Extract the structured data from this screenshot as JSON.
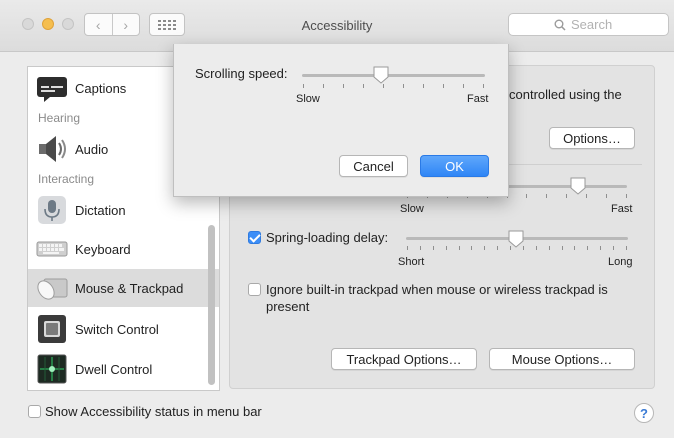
{
  "window": {
    "title": "Accessibility"
  },
  "toolbar": {
    "back_glyph": "‹",
    "forward_glyph": "›"
  },
  "search": {
    "placeholder": "Search"
  },
  "sidebar": {
    "items": [
      {
        "label": "Captions",
        "icon": "captions-icon"
      },
      {
        "label": "Audio",
        "icon": "speaker-icon"
      },
      {
        "label": "Dictation",
        "icon": "microphone-icon"
      },
      {
        "label": "Keyboard",
        "icon": "keyboard-icon"
      },
      {
        "label": "Mouse & Trackpad",
        "icon": "mouse-trackpad-icon",
        "selected": true
      },
      {
        "label": "Switch Control",
        "icon": "switch-control-icon"
      },
      {
        "label": "Dwell Control",
        "icon": "dwell-control-icon"
      }
    ],
    "headers": {
      "hearing": "Hearing",
      "interacting": "Interacting"
    }
  },
  "panel": {
    "partial_text": "controlled using the",
    "options_button": "Options…",
    "double_click_slider": {
      "min_label": "Slow",
      "max_label": "Fast",
      "value": 0.78
    },
    "spring_loading": {
      "label": "Spring-loading delay:",
      "checked": true,
      "min_label": "Short",
      "max_label": "Long",
      "value": 0.5
    },
    "ignore_trackpad": {
      "label_line1": "Ignore built-in trackpad when mouse or wireless trackpad is",
      "label_line2": "present",
      "checked": false
    },
    "trackpad_options_button": "Trackpad Options…",
    "mouse_options_button": "Mouse Options…"
  },
  "footer": {
    "status_checkbox_label": "Show Accessibility status in menu bar",
    "status_checked": false,
    "help_label": "?"
  },
  "sheet": {
    "scrolling_speed_label": "Scrolling speed:",
    "slider": {
      "min_label": "Slow",
      "max_label": "Fast",
      "value": 0.43
    },
    "cancel_button": "Cancel",
    "ok_button": "OK"
  },
  "colors": {
    "accent": "#3c8ef7",
    "selection": "#dcdcdc",
    "panel": "#e3e3e3"
  }
}
